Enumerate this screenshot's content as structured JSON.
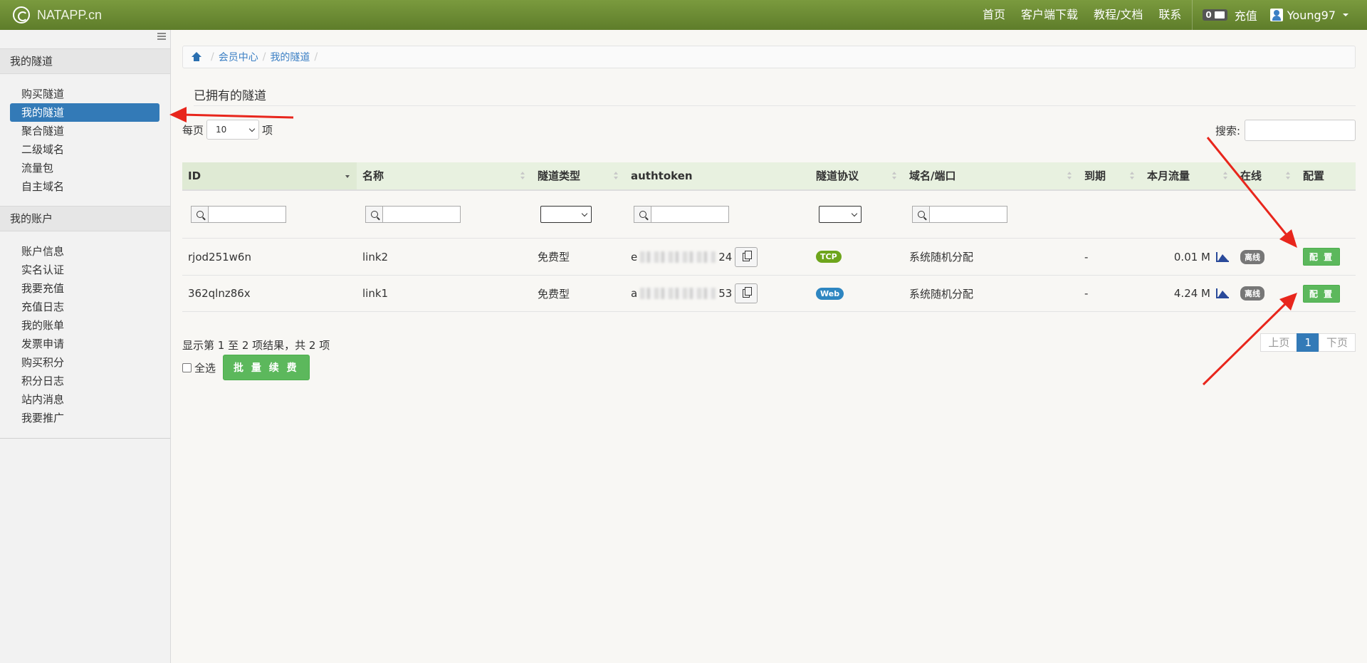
{
  "navbar": {
    "brand": "NATAPP.cn",
    "links": [
      "首页",
      "客户端下载",
      "教程/文档",
      "联系"
    ],
    "balance": "0",
    "recharge": "充值",
    "user": "Young97"
  },
  "sidebar": {
    "group1_title": "我的隧道",
    "group1_items": [
      "购买隧道",
      "我的隧道",
      "聚合隧道",
      "二级域名",
      "流量包",
      "自主域名"
    ],
    "group2_title": "我的账户",
    "group2_items": [
      "账户信息",
      "实名认证",
      "我要充值",
      "充值日志",
      "我的账单",
      "发票申请",
      "购买积分",
      "积分日志",
      "站内消息",
      "我要推广"
    ]
  },
  "breadcrumb": [
    "会员中心",
    "我的隧道"
  ],
  "page_title": "已拥有的隧道",
  "length": {
    "prefix": "每页",
    "value": "10",
    "suffix": "项"
  },
  "search": {
    "label": "搜索:"
  },
  "columns": [
    "ID",
    "名称",
    "隧道类型",
    "authtoken",
    "隧道协议",
    "域名/端口",
    "到期",
    "本月流量",
    "在线",
    "配置"
  ],
  "rows": [
    {
      "id": "rjod251w6n",
      "name": "link2",
      "type": "免费型",
      "token_start": "e",
      "token_end": "24",
      "protocol": "TCP",
      "domain": "系统随机分配",
      "expiry": "-",
      "traffic": "0.01 M",
      "online": "离线",
      "config": "配 置"
    },
    {
      "id": "362qlnz86x",
      "name": "link1",
      "type": "免费型",
      "token_start": "a",
      "token_end": "53",
      "protocol": "Web",
      "domain": "系统随机分配",
      "expiry": "-",
      "traffic": "4.24 M",
      "online": "离线",
      "config": "配 置"
    }
  ],
  "protocol_colors": {
    "TCP": "#6ea51c",
    "Web": "#2e86c1"
  },
  "info": "显示第 1 至 2 项结果，共 2 项",
  "select_all": "全选",
  "renew_button": "批 量 续 费",
  "pager": {
    "prev": "上页",
    "current": "1",
    "next": "下页"
  }
}
